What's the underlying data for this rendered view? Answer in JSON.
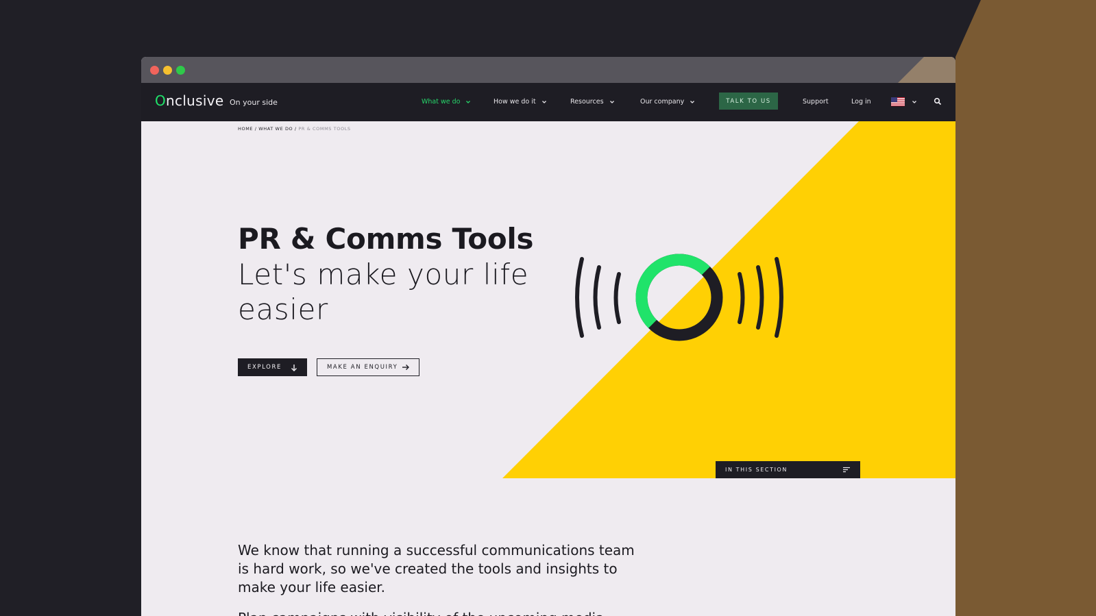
{
  "colors": {
    "desktop_bg": "#201f26",
    "desktop_accent": "#7a5a33",
    "titlebar": "#57555c",
    "nav_bg": "#1e1d24",
    "accent_green": "#26d66a",
    "hero_yellow": "#ffd004",
    "cta_green": "#2c6646",
    "page_bg": "#efebf0"
  },
  "browser": {
    "controls": [
      "close",
      "minimize",
      "maximize"
    ]
  },
  "nav": {
    "logo_initial": "O",
    "logo_rest": "nclusive",
    "tagline": "On your side",
    "items": [
      {
        "label": "What we do",
        "active": true
      },
      {
        "label": "How we do it",
        "active": false
      },
      {
        "label": "Resources",
        "active": false
      },
      {
        "label": "Our company",
        "active": false
      }
    ],
    "cta": "TALK TO US",
    "support": "Support",
    "login": "Log in",
    "region_icon": "us-flag-icon",
    "search_icon": "search-icon"
  },
  "breadcrumb": {
    "home": "HOME",
    "sep": " / ",
    "parent": "WHAT WE DO",
    "current": "PR & COMMS TOOLS"
  },
  "hero": {
    "title": "PR & Comms Tools",
    "subtitle": "Let's make your life easier",
    "explore_label": "EXPLORE",
    "enquiry_label": "MAKE AN ENQUIRY",
    "illustration_icon": "broadcast-signal-icon",
    "section_menu_label": "IN THIS SECTION"
  },
  "body": {
    "intro": "We know that running a successful communications team is hard work, so we've created the tools and insights to make your life easier.",
    "next_paragraph_start": "Plan campaigns with visibility of the upcoming media"
  }
}
